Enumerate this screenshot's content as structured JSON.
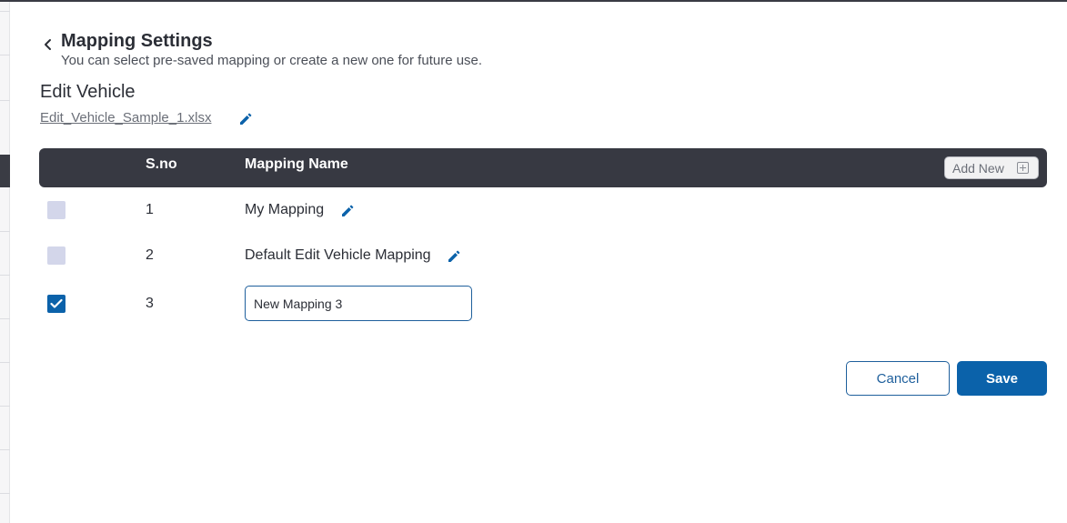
{
  "header": {
    "title": "Mapping Settings",
    "subtitle": "You can select pre-saved mapping or create a new one for future use."
  },
  "section": {
    "title": "Edit Vehicle",
    "file_name": "Edit_Vehicle_Sample_1.xlsx"
  },
  "table": {
    "columns": [
      "",
      "S.no",
      "Mapping Name"
    ],
    "add_new_label": "Add New",
    "rows": [
      {
        "sno": "1",
        "name": "My Mapping",
        "checked": false
      },
      {
        "sno": "2",
        "name": "Default Edit Vehicle Mapping",
        "checked": false
      },
      {
        "sno": "3",
        "name": "New Mapping 3",
        "checked": true,
        "editing": true
      }
    ]
  },
  "actions": {
    "cancel_label": "Cancel",
    "save_label": "Save"
  },
  "icons": {
    "back": "chevron-left-icon",
    "edit": "pencil-icon",
    "check": "check-icon",
    "add": "plus-square-icon"
  },
  "colors": {
    "primary": "#0b62aa",
    "header_bg": "#373942",
    "checkbox_off": "#d3d6ea",
    "text": "#2b2e36"
  }
}
